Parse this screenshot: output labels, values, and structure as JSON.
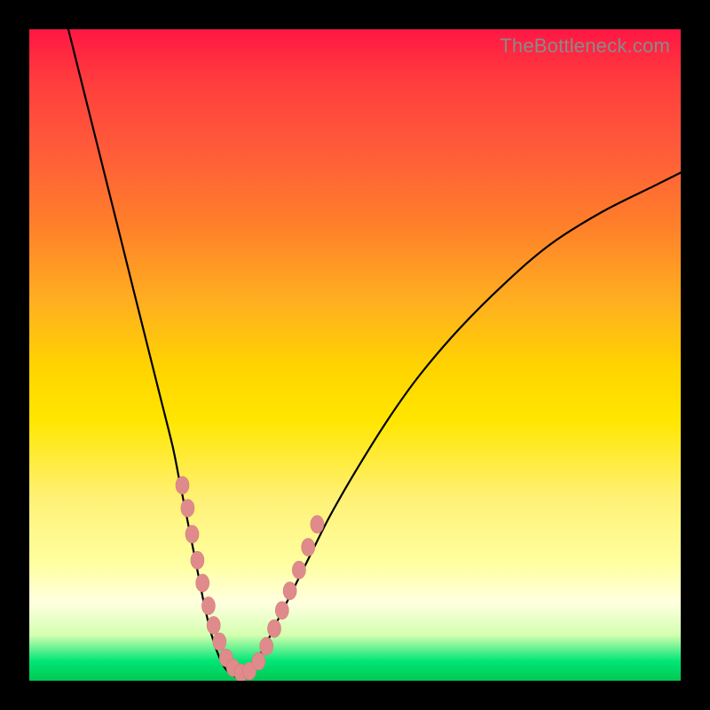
{
  "watermark": "TheBottleneck.com",
  "chart_data": {
    "type": "line",
    "title": "",
    "xlabel": "",
    "ylabel": "",
    "xlim": [
      0,
      100
    ],
    "ylim": [
      0,
      100
    ],
    "series": [
      {
        "name": "curve",
        "x": [
          6,
          8,
          10,
          12,
          14,
          16,
          18,
          20,
          22,
          23,
          24,
          25,
          26,
          27,
          28,
          29,
          30,
          31,
          32,
          33,
          34,
          36,
          38,
          40,
          43,
          46,
          50,
          55,
          60,
          66,
          73,
          80,
          88,
          96,
          100
        ],
        "y": [
          100,
          92,
          84,
          76,
          68,
          60,
          52,
          44,
          36,
          31,
          26,
          21,
          16,
          11,
          7,
          4,
          2,
          1,
          0.5,
          1,
          2,
          5,
          9,
          13,
          19,
          25,
          32,
          40,
          47,
          54,
          61,
          67,
          72,
          76,
          78
        ]
      }
    ],
    "highlight_dots": {
      "name": "marked-points",
      "x": [
        23.5,
        24.3,
        25.0,
        25.8,
        26.6,
        27.5,
        28.3,
        29.2,
        30.2,
        31.3,
        32.5,
        33.8,
        35.2,
        36.4,
        37.6,
        38.8,
        40.0,
        41.4,
        42.8,
        44.2
      ],
      "y": [
        30,
        26.5,
        22.5,
        18.5,
        15,
        11.5,
        8.5,
        6,
        3.5,
        2,
        1.2,
        1.5,
        3,
        5.3,
        8,
        10.8,
        13.8,
        17,
        20.5,
        24
      ]
    }
  }
}
